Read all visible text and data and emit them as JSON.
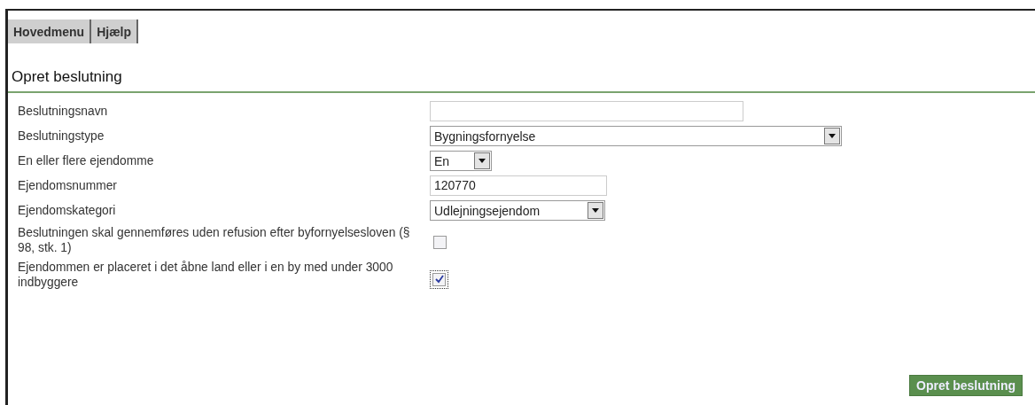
{
  "tabs": [
    {
      "label": "Hovedmenu",
      "selected": false
    },
    {
      "label": "Hjælp",
      "selected": false
    }
  ],
  "title": "Opret beslutning",
  "fields": [
    {
      "label": "Beslutningsnavn",
      "kind": "text"
    },
    {
      "label": "Beslutningstype",
      "kind": "select",
      "value": "Bygningsfornyelse"
    },
    {
      "label": "En eller flere ejendomme",
      "kind": "select",
      "value": "En"
    },
    {
      "label": "Ejendomsnummer",
      "kind": "text",
      "value": "120770"
    },
    {
      "label": "Ejendomskategori",
      "kind": "select",
      "value": "Udlejningsejendom"
    },
    {
      "label": "Beslutningen skal gennemføres uden refusion efter byfornyelsesloven (§ 98, stk. 1)",
      "kind": "checkbox",
      "checked": false,
      "focused": false
    },
    {
      "label": "Ejendommen er placeret i det åbne land eller i en by med under 3000 indbyggere",
      "kind": "checkbox",
      "checked": true,
      "focused": true
    }
  ],
  "submit": "Opret beslutning"
}
